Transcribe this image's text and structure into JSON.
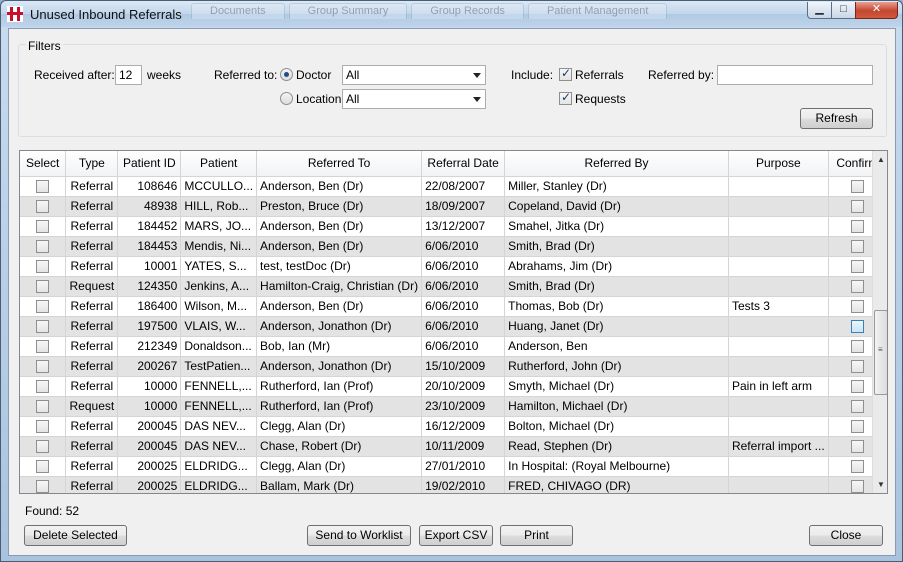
{
  "window": {
    "title": "Unused Inbound Referrals",
    "background_tabs": [
      "Documents",
      "Group Summary",
      "Group Records",
      "Patient Management"
    ],
    "min_glyph": "▁",
    "max_glyph": "□",
    "close_glyph": "✕"
  },
  "filters": {
    "legend": "Filters",
    "received_after_label": "Received after:",
    "received_after_value": "12",
    "weeks_label": "weeks",
    "referred_to_label": "Referred to:",
    "doctor_label": "Doctor",
    "doctor_value": "All",
    "location_label": "Location",
    "location_value": "All",
    "include_label": "Include:",
    "referrals_label": "Referrals",
    "requests_label": "Requests",
    "referred_by_label": "Referred by:",
    "referred_by_value": "",
    "refresh_label": "Refresh"
  },
  "grid": {
    "columns": [
      "Select",
      "Type",
      "Patient ID",
      "Patient",
      "Referred To",
      "Referral Date",
      "Referred By",
      "Purpose",
      "Confirm"
    ],
    "rows": [
      {
        "type": "Referral",
        "id": "108646",
        "patient": "MCCULLO...",
        "to": "Anderson, Ben (Dr)",
        "date": "22/08/2007",
        "by": "Miller, Stanley (Dr)",
        "purpose": ""
      },
      {
        "type": "Referral",
        "id": "48938",
        "patient": "HILL, Rob...",
        "to": "Preston, Bruce (Dr)",
        "date": "18/09/2007",
        "by": "Copeland, David (Dr)",
        "purpose": ""
      },
      {
        "type": "Referral",
        "id": "184452",
        "patient": "MARS, JO...",
        "to": "Anderson, Ben (Dr)",
        "date": "13/12/2007",
        "by": "Smahel, Jitka (Dr)",
        "purpose": ""
      },
      {
        "type": "Referral",
        "id": "184453",
        "patient": "Mendis, Ni...",
        "to": "Anderson, Ben (Dr)",
        "date": "6/06/2010",
        "by": "Smith, Brad (Dr)",
        "purpose": ""
      },
      {
        "type": "Referral",
        "id": "10001",
        "patient": "YATES, S...",
        "to": "test, testDoc (Dr)",
        "date": "6/06/2010",
        "by": "Abrahams, Jim (Dr)",
        "purpose": ""
      },
      {
        "type": "Request",
        "id": "124350",
        "patient": "Jenkins, A...",
        "to": "Hamilton-Craig, Christian (Dr)",
        "date": "6/06/2010",
        "by": "Smith, Brad (Dr)",
        "purpose": ""
      },
      {
        "type": "Referral",
        "id": "186400",
        "patient": "Wilson, M...",
        "to": "Anderson, Ben (Dr)",
        "date": "6/06/2010",
        "by": "Thomas, Bob (Dr)",
        "purpose": "Tests 3"
      },
      {
        "type": "Referral",
        "id": "197500",
        "patient": "VLAIS, W...",
        "to": "Anderson, Jonathon (Dr)",
        "date": "6/06/2010",
        "by": "Huang, Janet (Dr)",
        "purpose": ""
      },
      {
        "type": "Referral",
        "id": "212349",
        "patient": "Donaldson...",
        "to": "Bob, Ian (Mr)",
        "date": "6/06/2010",
        "by": "Anderson, Ben",
        "purpose": ""
      },
      {
        "type": "Referral",
        "id": "200267",
        "patient": "TestPatien...",
        "to": "Anderson, Jonathon (Dr)",
        "date": "15/10/2009",
        "by": "Rutherford, John (Dr)",
        "purpose": ""
      },
      {
        "type": "Referral",
        "id": "10000",
        "patient": "FENNELL,...",
        "to": "Rutherford, Ian (Prof)",
        "date": "20/10/2009",
        "by": "Smyth, Michael (Dr)",
        "purpose": "Pain in left arm"
      },
      {
        "type": "Request",
        "id": "10000",
        "patient": "FENNELL,...",
        "to": "Rutherford, Ian (Prof)",
        "date": "23/10/2009",
        "by": "Hamilton, Michael (Dr)",
        "purpose": ""
      },
      {
        "type": "Referral",
        "id": "200045",
        "patient": "DAS NEV...",
        "to": "Clegg, Alan (Dr)",
        "date": "16/12/2009",
        "by": "Bolton, Michael (Dr)",
        "purpose": ""
      },
      {
        "type": "Referral",
        "id": "200045",
        "patient": "DAS NEV...",
        "to": "Chase, Robert (Dr)",
        "date": "10/11/2009",
        "by": "Read, Stephen (Dr)",
        "purpose": "Referral import ..."
      },
      {
        "type": "Referral",
        "id": "200025",
        "patient": "ELDRIDG...",
        "to": "Clegg, Alan (Dr)",
        "date": "27/01/2010",
        "by": "In Hospital: (Royal Melbourne)",
        "purpose": ""
      },
      {
        "type": "Referral",
        "id": "200025",
        "patient": "ELDRIDG...",
        "to": "Ballam, Mark (Dr)",
        "date": "19/02/2010",
        "by": "FRED, CHIVAGO (DR)",
        "purpose": ""
      }
    ]
  },
  "footer": {
    "found_label": "Found: 52",
    "delete_label": "Delete Selected",
    "send_label": "Send to Worklist",
    "export_label": "Export CSV",
    "print_label": "Print",
    "close_label": "Close"
  }
}
